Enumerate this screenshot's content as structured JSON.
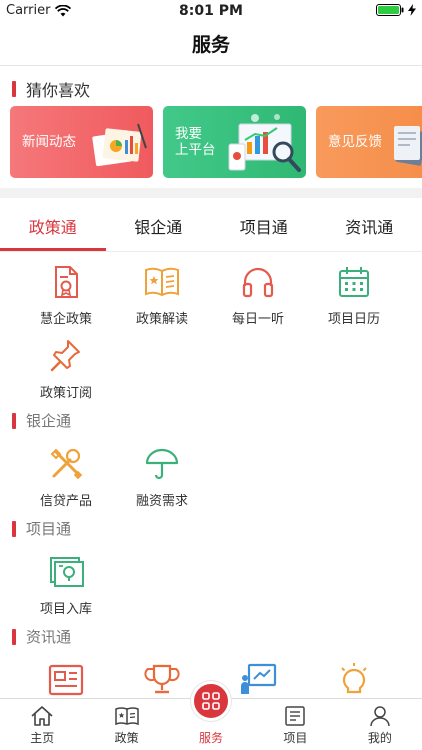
{
  "status": {
    "carrier": "Carrier",
    "time": "8:01 PM"
  },
  "nav": {
    "title": "服务"
  },
  "guess": {
    "title": "猜你喜欢",
    "cards": [
      {
        "label": "新闻动态",
        "color": "#f26b6b"
      },
      {
        "label_line1": "我要",
        "label_line2": "上平台",
        "color": "#37c37f"
      },
      {
        "label": "意见反馈",
        "color": "#f6904a"
      }
    ]
  },
  "tabs": {
    "active": 0,
    "items": [
      {
        "label": "政策通"
      },
      {
        "label": "银企通"
      },
      {
        "label": "项目通"
      },
      {
        "label": "资讯通"
      }
    ]
  },
  "sections": {
    "policy": {
      "items": [
        {
          "label": "慧企政策",
          "icon": "policy-doc-icon"
        },
        {
          "label": "政策解读",
          "icon": "book-star-icon"
        },
        {
          "label": "每日一听",
          "icon": "headphones-icon"
        },
        {
          "label": "项目日历",
          "icon": "calendar-icon"
        },
        {
          "label": "政策订阅",
          "icon": "pin-icon"
        }
      ]
    },
    "bank": {
      "title": "银企通",
      "items": [
        {
          "label": "信贷产品",
          "icon": "tools-icon"
        },
        {
          "label": "融资需求",
          "icon": "umbrella-icon"
        }
      ]
    },
    "project": {
      "title": "项目通",
      "items": [
        {
          "label": "项目入库",
          "icon": "project-storage-icon"
        }
      ]
    },
    "info": {
      "title": "资讯通",
      "items": [
        {
          "icon": "newspaper-icon"
        },
        {
          "icon": "trophy-icon"
        },
        {
          "icon": "presentation-icon"
        },
        {
          "icon": "lightbulb-icon"
        }
      ]
    }
  },
  "tabbar": {
    "items": [
      {
        "label": "主页",
        "icon": "home-icon"
      },
      {
        "label": "政策",
        "icon": "policy-book-icon"
      },
      {
        "label": "服务",
        "icon": "service-grid-icon"
      },
      {
        "label": "项目",
        "icon": "project-list-icon"
      },
      {
        "label": "我的",
        "icon": "profile-icon"
      }
    ],
    "active": 2
  },
  "colors": {
    "accent": "#d9373d",
    "orange": "#f0a23a",
    "green": "#3bb07a"
  }
}
